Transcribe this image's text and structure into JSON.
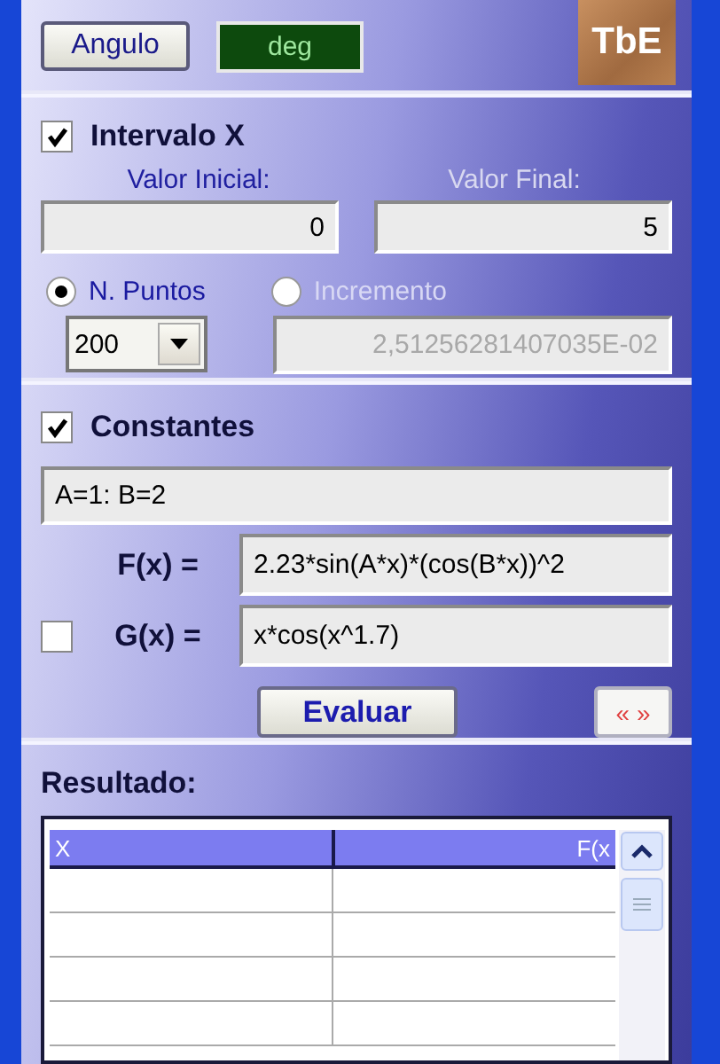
{
  "angle": {
    "button": "Angulo",
    "mode": "deg"
  },
  "logo": "TbE",
  "interval": {
    "checked": true,
    "title": "Intervalo X",
    "start_label": "Valor Inicial:",
    "start_value": "0",
    "end_label": "Valor Final:",
    "end_value": "5",
    "modes": [
      {
        "label": "N. Puntos",
        "selected": true
      },
      {
        "label": "Incremento",
        "selected": false
      }
    ],
    "points": "200",
    "increment": "2,51256281407035E-02",
    "increment_disabled": true
  },
  "constants": {
    "checked": true,
    "title": "Constantes",
    "value": "A=1: B=2"
  },
  "functions": [
    {
      "kind": "plain",
      "label": "F(x) =",
      "value": "2.23*sin(A*x)*(cos(B*x))^2"
    },
    {
      "kind": "checkbox",
      "checked": false,
      "label": "G(x) =",
      "value": "x*cos(x^1.7)"
    }
  ],
  "evaluate_button": "Evaluar",
  "toggle_button": "« »",
  "result": {
    "title": "Resultado:",
    "columns": [
      "X",
      "F(x"
    ]
  }
}
